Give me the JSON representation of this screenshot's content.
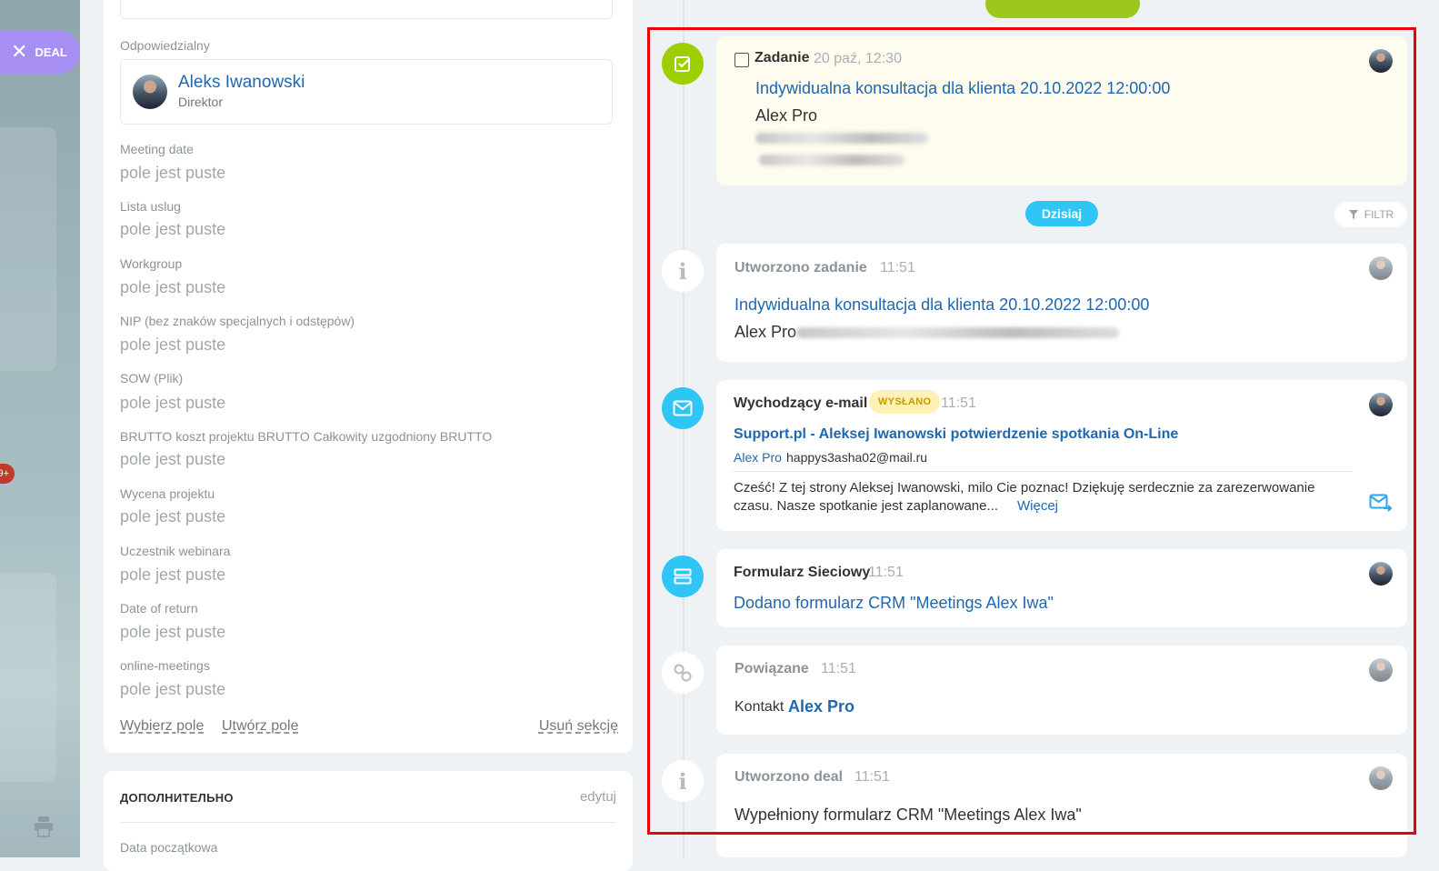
{
  "deal_tab": {
    "label": "DEAL"
  },
  "badge": {
    "text": "9+"
  },
  "left": {
    "responsible": {
      "label": "Odpowiedzialny",
      "name": "Aleks Iwanowski",
      "role": "Direktor"
    },
    "fields": [
      {
        "label": "Meeting date",
        "value": "pole jest puste"
      },
      {
        "label": "Lista uslug",
        "value": "pole jest puste"
      },
      {
        "label": "Workgroup",
        "value": "pole jest puste"
      },
      {
        "label": "NIP (bez znaków specjalnych i odstępów)",
        "value": "pole jest puste"
      },
      {
        "label": "SOW (Plik)",
        "value": "pole jest puste"
      },
      {
        "label": "BRUTTO koszt projektu BRUTTO Całkowity uzgodniony BRUTTO",
        "value": "pole jest puste"
      },
      {
        "label": "Wycena projektu",
        "value": "pole jest puste"
      },
      {
        "label": "Uczestnik webinara",
        "value": "pole jest puste"
      },
      {
        "label": "Date of return",
        "value": "pole jest puste"
      },
      {
        "label": "online-meetings",
        "value": "pole jest puste"
      }
    ],
    "actions": {
      "choose": "Wybierz pole",
      "create": "Utwórz pole",
      "delete": "Usuń sekcję"
    },
    "extra": {
      "title": "ДОПОЛНИТЕЛЬНО",
      "edit": "edytuj",
      "field": "Data początkowa"
    }
  },
  "timeline": {
    "task": {
      "title": "Zadanie",
      "time": "20 paź, 12:30",
      "link": "Indywidualna konsultacja dla klienta 20.10.2022 12:00:00",
      "contact": "Alex Pro"
    },
    "today": "Dzisiaj",
    "filter": "FILTR",
    "created_task": {
      "title": "Utworzono zadanie",
      "time": "11:51",
      "link": "Indywidualna konsultacja dla klienta 20.10.2022 12:00:00",
      "contact": "Alex Pro"
    },
    "email": {
      "title": "Wychodzący e-mail",
      "status": "WYSŁANO",
      "time": "11:51",
      "subject": "Support.pl - Aleksej Iwanowski potwierdzenie spotkania On-Line",
      "from_name": "Alex Pro",
      "from_email": "happys3asha02@mail.ru",
      "body_line1": "Cześć! Z tej strony Aleksej Iwanowski, milo Cie poznac! Dziękuję serdecznie za zarezerwowanie",
      "body_line2": "czasu. Nasze spotkanie jest zaplanowane...",
      "more": "Więcej"
    },
    "form": {
      "title": "Formularz Sieciowy",
      "time": "11:51",
      "link": "Dodano formularz CRM \"Meetings Alex Iwa\""
    },
    "linked": {
      "title": "Powiązane",
      "time": "11:51",
      "label": "Kontakt",
      "link": "Alex Pro"
    },
    "created_deal": {
      "title": "Utworzono deal",
      "time": "11:51",
      "text": "Wypełniony formularz CRM \"Meetings Alex Iwa\""
    }
  },
  "colors": {
    "green": "#9dcf00",
    "blue": "#2fc6f6",
    "link": "#2067b0",
    "highlight": "#e8000b"
  }
}
